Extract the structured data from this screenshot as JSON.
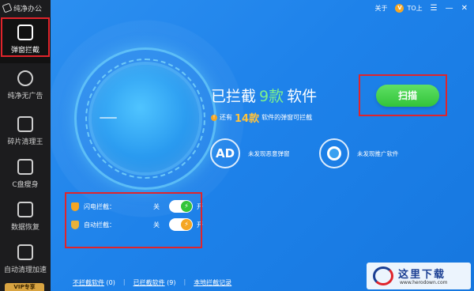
{
  "app": {
    "title": "纯净办公"
  },
  "sidebar": {
    "items": [
      {
        "label": "弹窗拦截",
        "icon": "block-popup-icon"
      },
      {
        "label": "纯净无广告",
        "icon": "no-ads-icon"
      },
      {
        "label": "碎片清理王",
        "icon": "cleanup-icon"
      },
      {
        "label": "C盘瘦身",
        "icon": "disk-slim-icon"
      },
      {
        "label": "数据恢复",
        "icon": "data-recovery-icon"
      },
      {
        "label": "自动清理加速",
        "icon": "auto-clean-icon"
      }
    ],
    "vip_label": "VIP专享"
  },
  "top_bar": {
    "about": "关于",
    "user": "TO上",
    "coin": "V"
  },
  "summary": {
    "prefix": "已拦截",
    "count": "9款",
    "suffix": "软件",
    "sub_prefix": "还有",
    "sub_num": "14款",
    "sub_suffix": "软件的弹窗可拦截"
  },
  "scan_button": {
    "label": "扫描"
  },
  "features": [
    {
      "icon_text": "AD",
      "label": "未发现恶意弹窗"
    },
    {
      "icon_text": "",
      "label": "未发现推广软件"
    }
  ],
  "toggles": [
    {
      "label": "闪电拦截：",
      "off": "关",
      "on": "开",
      "knob": "⚡"
    },
    {
      "label": "自动拦截：",
      "off": "关",
      "on": "开",
      "knob": "⚡"
    }
  ],
  "bottom_links": [
    {
      "label": "不拦截软件",
      "count": "(0)"
    },
    {
      "label": "已拦截软件",
      "count": "(9)"
    },
    {
      "label": "本地拦截记录",
      "count": ""
    }
  ],
  "watermark": {
    "text": "这里下载",
    "url": "www.herodown.com"
  },
  "colors": {
    "accent": "#2c8ff0",
    "green": "#33c43a",
    "highlight": "#e0242b",
    "warning": "#f5a623"
  }
}
